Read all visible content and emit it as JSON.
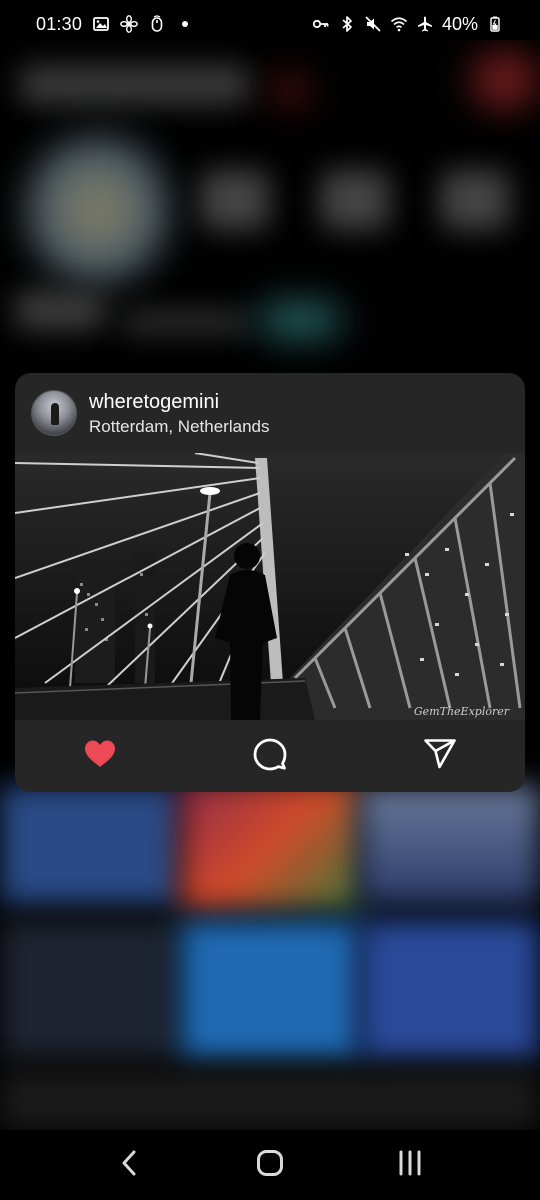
{
  "status_bar": {
    "time": "01:30",
    "battery_percent": "40%",
    "left_icons": [
      "gallery-icon",
      "fan-icon",
      "mouse-icon",
      "dot-icon"
    ],
    "right_icons": [
      "key-icon",
      "bluetooth-icon",
      "mute-icon",
      "wifi-icon",
      "airplane-icon",
      "battery-icon"
    ]
  },
  "preview": {
    "username": "wheretogemini",
    "location": "Rotterdam, Netherlands",
    "watermark": "GemTheExplorer",
    "actions": {
      "like_icon": "heart-icon",
      "like_color": "#ed4956",
      "comment_icon": "comment-icon",
      "share_icon": "send-icon"
    }
  },
  "nav_bar": {
    "buttons": [
      "back-icon",
      "home-icon",
      "recents-icon"
    ]
  },
  "colors": {
    "card_background": "#262626",
    "accent_heart": "#ed4956"
  }
}
